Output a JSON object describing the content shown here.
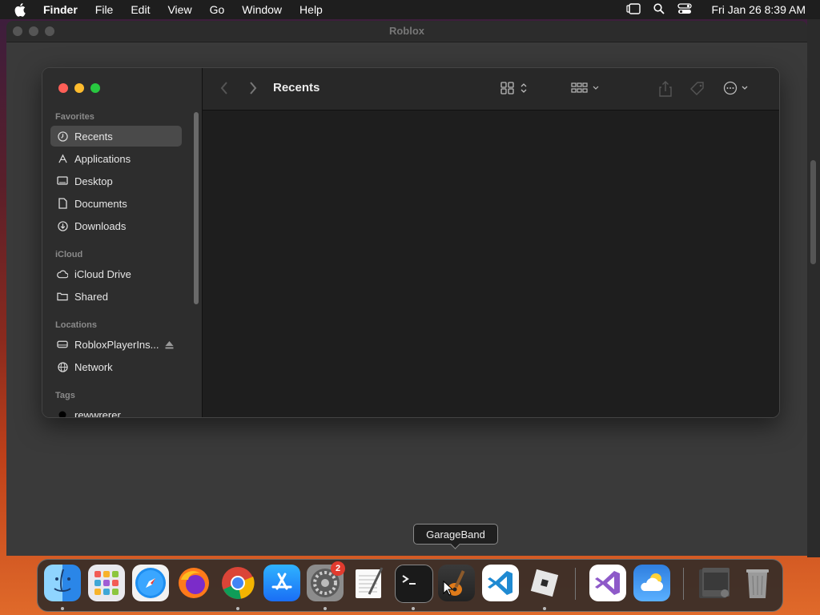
{
  "menubar": {
    "items": [
      "Finder",
      "File",
      "Edit",
      "View",
      "Go",
      "Window",
      "Help"
    ],
    "clock": "Fri Jan 26  8:39 AM",
    "icons": [
      "stage-manager-icon",
      "search-icon",
      "control-center-icon"
    ]
  },
  "outer_window": {
    "title": "Roblox"
  },
  "finder": {
    "title": "Recents",
    "sidebar": {
      "favorites_label": "Favorites",
      "favorites": [
        {
          "label": "Recents",
          "icon": "clock-icon",
          "selected": true
        },
        {
          "label": "Applications",
          "icon": "applications-icon"
        },
        {
          "label": "Desktop",
          "icon": "desktop-icon"
        },
        {
          "label": "Documents",
          "icon": "document-icon"
        },
        {
          "label": "Downloads",
          "icon": "download-icon"
        }
      ],
      "icloud_label": "iCloud",
      "icloud": [
        {
          "label": "iCloud Drive",
          "icon": "cloud-icon"
        },
        {
          "label": "Shared",
          "icon": "shared-folder-icon"
        }
      ],
      "locations_label": "Locations",
      "locations": [
        {
          "label": "RobloxPlayerIns...",
          "icon": "disk-icon"
        },
        {
          "label": "Network",
          "icon": "network-icon"
        }
      ],
      "tags_label": "Tags",
      "tags": [
        {
          "label": "rewwrerer",
          "color": "#000000"
        }
      ]
    },
    "toolbar_icons": [
      "back-icon",
      "forward-icon",
      "view-grid-icon",
      "group-icon",
      "share-icon",
      "tag-icon",
      "more-icon",
      "search-icon"
    ]
  },
  "tooltip": "GarageBand",
  "dock": {
    "apps": [
      "Finder",
      "Launchpad",
      "Safari",
      "Firefox",
      "Chrome",
      "App Store",
      "System Settings",
      "TextEdit",
      "Terminal",
      "GarageBand",
      "Visual Studio Code",
      "Roblox",
      "Visual Studio",
      "Weather",
      "Downloads Stack",
      "Trash"
    ],
    "settings_badge": "2"
  },
  "colors": {
    "red_light": "#ff5f57",
    "yellow_light": "#febc2e",
    "green_light": "#28c840",
    "accent": "#0a84ff"
  }
}
